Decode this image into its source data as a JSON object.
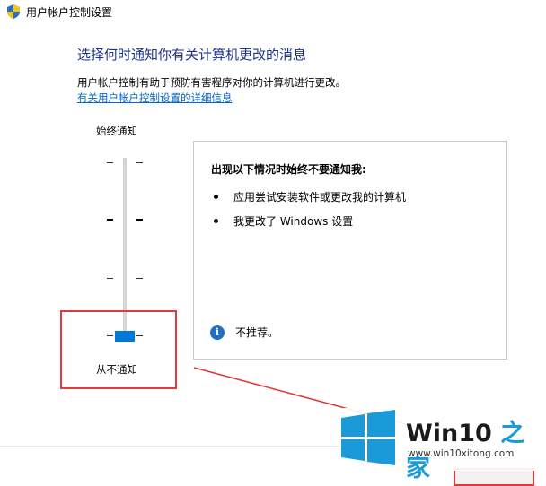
{
  "window": {
    "title": "用户帐户控制设置"
  },
  "main": {
    "heading": "选择何时通知你有关计算机更改的消息",
    "description": "用户帐户控制有助于预防有害程序对你的计算机进行更改。",
    "link": "有关用户帐户控制设置的详细信息"
  },
  "slider": {
    "top_label": "始终通知",
    "bottom_label": "从不通知",
    "levels": 4,
    "selected_level": 1,
    "thumb_color": "#0078d7"
  },
  "info_panel": {
    "title": "出现以下情况时始终不要通知我:",
    "bullets": [
      "应用尝试安装软件或更改我的计算机",
      "我更改了 Windows 设置"
    ],
    "note_icon": "info-icon",
    "note": "不推荐。"
  },
  "watermark": {
    "title_prefix": "Win10",
    "title_suffix": " 之家",
    "url": "www.win10xitong.com",
    "logo_color": "#1a9ad6"
  },
  "colors": {
    "highlight": "#e03a3a",
    "heading": "#1e3287",
    "link": "#0066cc"
  }
}
